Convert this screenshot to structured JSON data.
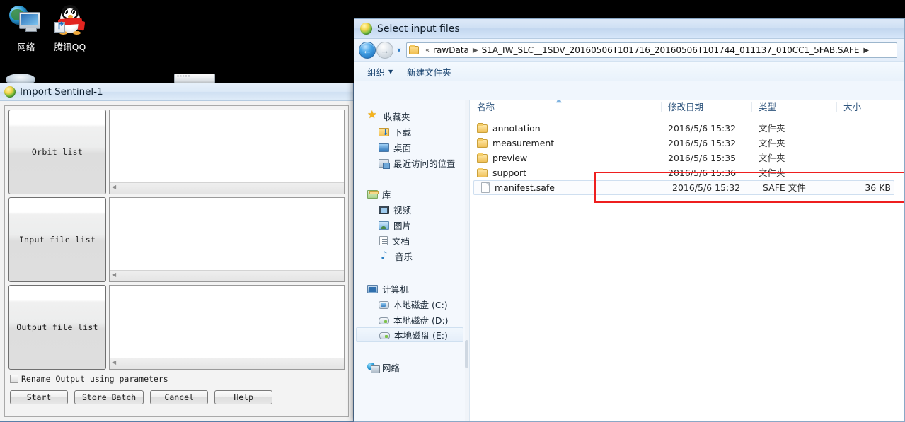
{
  "desktop": {
    "icons": [
      {
        "name": "网络",
        "glyph": "network-globe-monitor"
      },
      {
        "name": "腾讯QQ",
        "glyph": "qq-penguin"
      }
    ]
  },
  "sentinel_window": {
    "title": "Import Sentinel-1",
    "title_icon": "globe-icon",
    "panels": [
      {
        "label": "Orbit list"
      },
      {
        "label": "Input file list"
      },
      {
        "label": "Output file list"
      }
    ],
    "checkbox": {
      "label": "Rename Output using parameters",
      "checked": false
    },
    "buttons": [
      {
        "label": "Start"
      },
      {
        "label": "Store Batch"
      },
      {
        "label": "Cancel"
      },
      {
        "label": "Help"
      }
    ]
  },
  "file_dialog": {
    "title": "Select input files",
    "title_icon": "globe-icon",
    "nav": {
      "back_glyph": "←",
      "forward_glyph": "→",
      "dropdown_glyph": "▼",
      "forward_arrow_glyph": "▶"
    },
    "breadcrumb": {
      "prefix": "«",
      "items": [
        "rawData",
        "S1A_IW_SLC__1SDV_20160506T101716_20160506T101744_011137_010CC1_5FAB.SAFE"
      ],
      "separator": "▶"
    },
    "toolbar": {
      "organize": "组织",
      "organize_caret": "▼",
      "new_folder": "新建文件夹"
    },
    "sidebar": {
      "groups": [
        {
          "header": {
            "label": "收藏夹",
            "icon": "star-icon"
          },
          "items": [
            {
              "label": "下载",
              "icon": "downloads-icon"
            },
            {
              "label": "桌面",
              "icon": "desktop-icon"
            },
            {
              "label": "最近访问的位置",
              "icon": "recent-places-icon"
            }
          ]
        },
        {
          "header": {
            "label": "库",
            "icon": "library-icon"
          },
          "items": [
            {
              "label": "视频",
              "icon": "video-icon"
            },
            {
              "label": "图片",
              "icon": "pictures-icon"
            },
            {
              "label": "文档",
              "icon": "documents-icon"
            },
            {
              "label": "音乐",
              "icon": "music-icon"
            }
          ]
        },
        {
          "header": {
            "label": "计算机",
            "icon": "computer-icon"
          },
          "items": [
            {
              "label": "本地磁盘 (C:)",
              "icon": "hard-disk-icon",
              "selected": false
            },
            {
              "label": "本地磁盘 (D:)",
              "icon": "disk-icon",
              "selected": false
            },
            {
              "label": "本地磁盘 (E:)",
              "icon": "disk-icon",
              "selected": true
            }
          ]
        },
        {
          "header": {
            "label": "网络",
            "icon": "network-icon"
          },
          "items": []
        }
      ]
    },
    "file_list": {
      "columns": [
        "名称",
        "修改日期",
        "类型",
        "大小"
      ],
      "sort_indicator": "▲",
      "rows": [
        {
          "name": "annotation",
          "modified": "2016/5/6 15:32",
          "type": "文件夹",
          "size": "",
          "icon": "folder-icon",
          "selected": false
        },
        {
          "name": "measurement",
          "modified": "2016/5/6 15:32",
          "type": "文件夹",
          "size": "",
          "icon": "folder-icon",
          "selected": false
        },
        {
          "name": "preview",
          "modified": "2016/5/6 15:35",
          "type": "文件夹",
          "size": "",
          "icon": "folder-icon",
          "selected": false
        },
        {
          "name": "support",
          "modified": "2016/5/6 15:36",
          "type": "文件夹",
          "size": "",
          "icon": "folder-icon",
          "selected": false
        },
        {
          "name": "manifest.safe",
          "modified": "2016/5/6 15:32",
          "type": "SAFE 文件",
          "size": "36 KB",
          "icon": "file-icon",
          "selected": true
        }
      ]
    },
    "annotation": {
      "type": "red-rectangle",
      "color": "#ee1f1f"
    }
  }
}
